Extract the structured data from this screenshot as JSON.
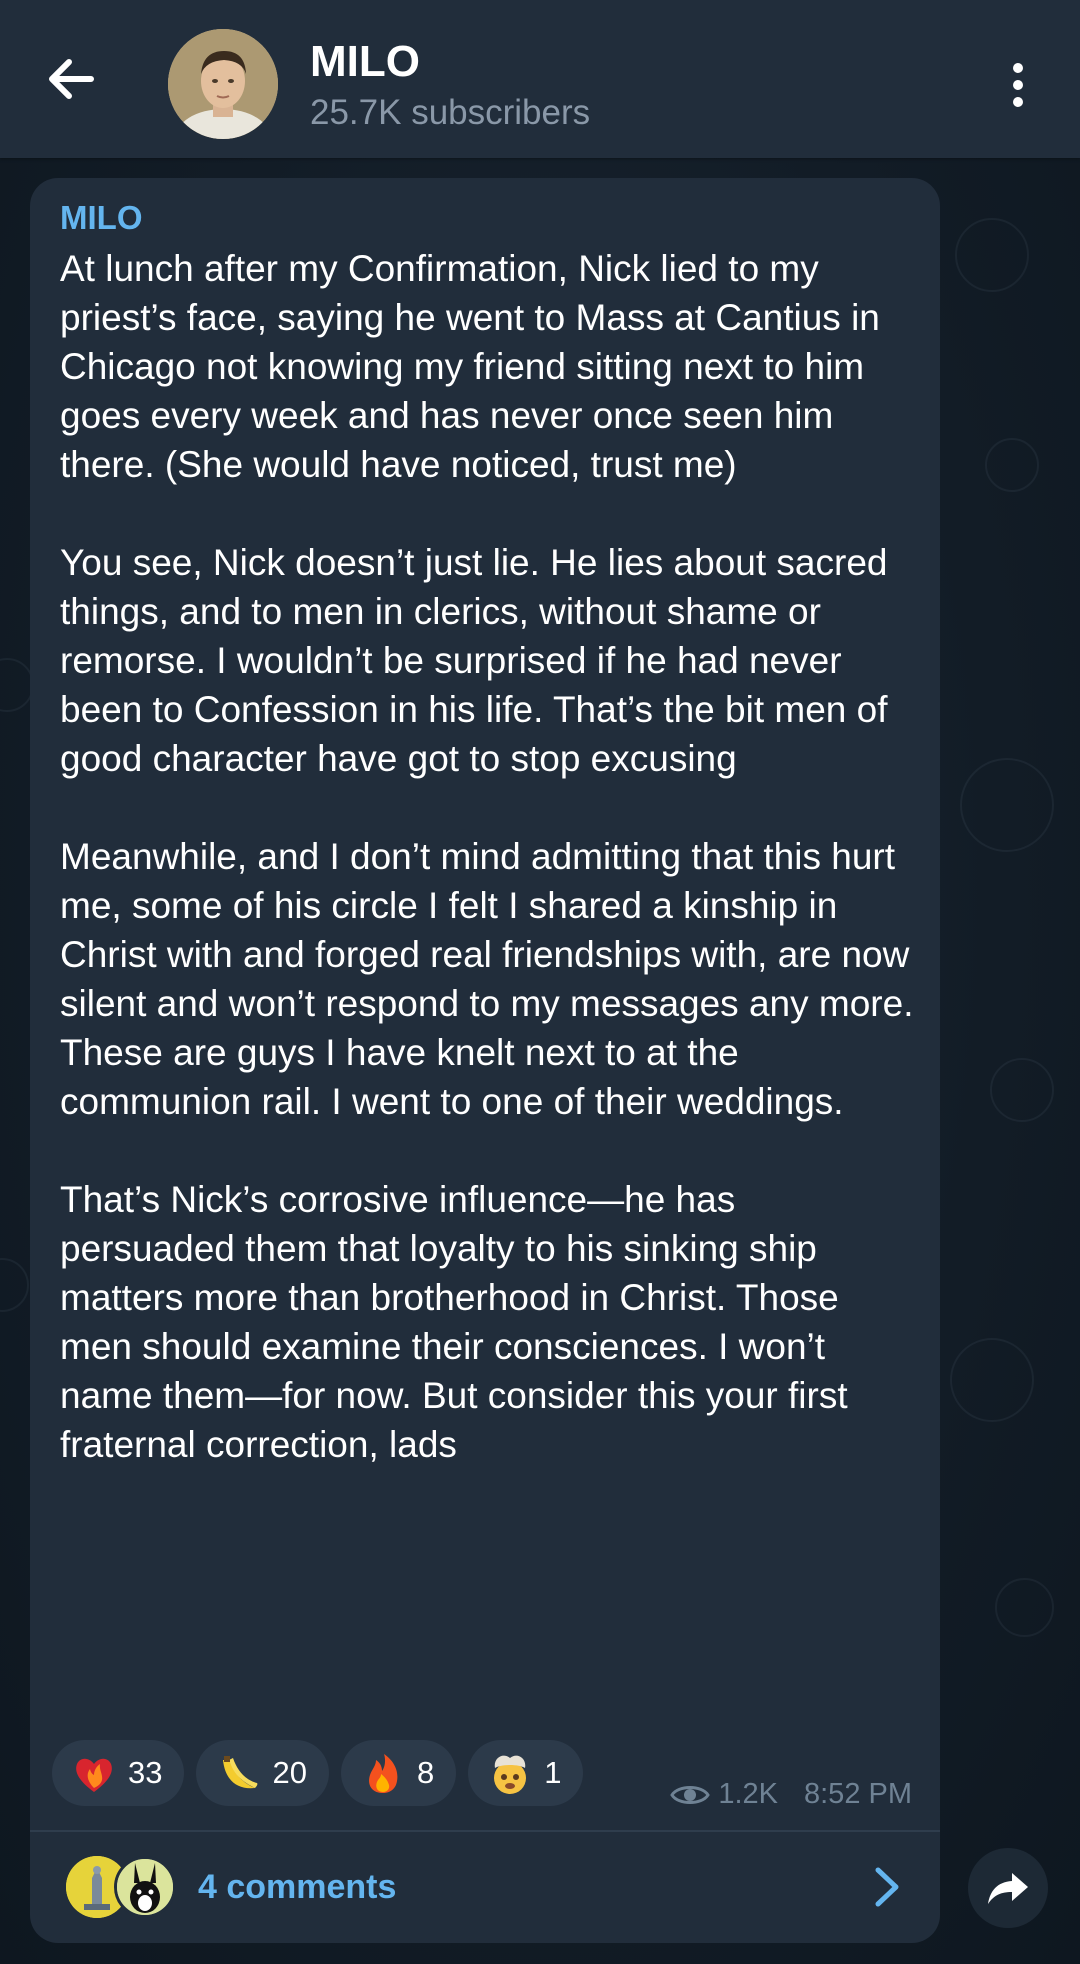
{
  "header": {
    "title": "MILO",
    "subtitle": "25.7K subscribers"
  },
  "message": {
    "sender": "MILO",
    "text": "At lunch after my Confirmation, Nick lied to my priest’s face, saying he went to Mass at Cantius in Chicago not knowing my friend sitting next to him goes every week and has never once seen him there. (She would have noticed, trust me)\n\nYou see, Nick doesn’t just lie. He lies about sacred things, and to men in clerics, without shame or remorse. I wouldn’t be surprised if he had never been to Confession in his life. That’s the bit men of good character have got to stop excusing\n\nMeanwhile, and I don’t mind admitting that this hurt me, some of his circle I felt I shared a kinship in Christ with and forged real friendships with, are now silent and won’t respond to my messages any more. These are guys I have knelt next to at the communion rail. I went to one of their weddings.\n\nThat’s Nick’s corrosive influence—he has persuaded them that loyalty to his sinking ship matters more than brotherhood in Christ. Those men should examine their consciences. I won’t name them—for now. But consider this your first fraternal correction, lads",
    "views": "1.2K",
    "time": "8:52 PM",
    "reactions": [
      {
        "icon": "heart-on-fire-icon",
        "count": "33"
      },
      {
        "icon": "banana-icon",
        "count": "20"
      },
      {
        "icon": "fire-icon",
        "count": "8"
      },
      {
        "icon": "exploding-head-icon",
        "count": "1"
      }
    ],
    "comments_label": "4 comments"
  },
  "colors": {
    "header_bg": "#212d3b",
    "bubble_bg": "#212d3b",
    "accent": "#64b5ef",
    "muted": "#6f8294"
  }
}
